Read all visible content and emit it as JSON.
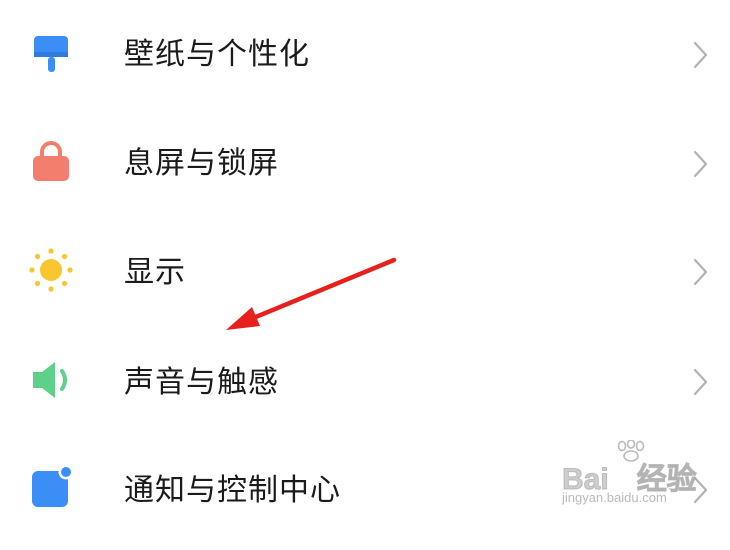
{
  "settings": {
    "items": [
      {
        "label": "壁纸与个性化",
        "icon": "wallpaper-brush-icon",
        "icon_color": "#3a8ef6"
      },
      {
        "label": "息屏与锁屏",
        "icon": "lock-icon",
        "icon_color": "#f47e6e"
      },
      {
        "label": "显示",
        "icon": "sun-icon",
        "icon_color": "#f9c630"
      },
      {
        "label": "声音与触感",
        "icon": "speaker-icon",
        "icon_color": "#5fd08a"
      },
      {
        "label": "通知与控制中心",
        "icon": "notification-icon",
        "icon_color": "#3a8ef6"
      }
    ],
    "chevron_icon": "chevron-right-icon",
    "chevron_color": "#b3b3b3"
  },
  "annotation": {
    "arrow_color": "#e8201c"
  },
  "watermark": {
    "brand": "Bai",
    "brand_suffix": "经验",
    "url": "jingyan.baidu.com"
  }
}
